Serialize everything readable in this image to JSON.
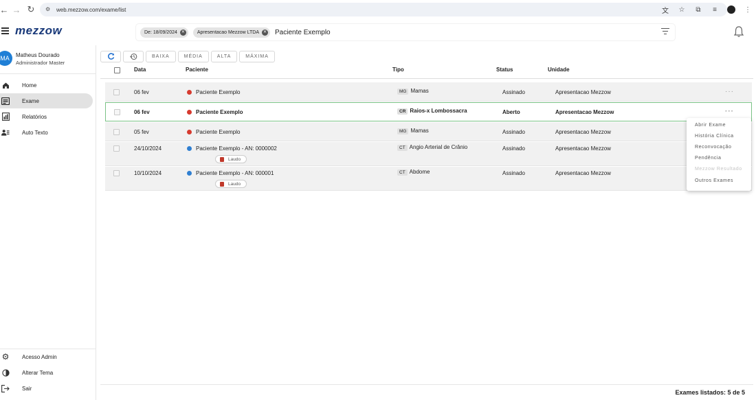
{
  "browser": {
    "url": "web.mezzow.com/exame/list"
  },
  "app": {
    "logo": "mezzow",
    "search": {
      "chips": [
        "De: 18/09/2024",
        "Apresentacao Mezzow LTDA"
      ],
      "query": "Paciente Exemplo"
    }
  },
  "user": {
    "initials": "MA",
    "name": "Matheus Dourado",
    "role": "Administrador Master"
  },
  "nav": {
    "items": [
      {
        "label": "Home",
        "icon": "home-icon"
      },
      {
        "label": "Exame",
        "icon": "exam-list-icon",
        "active": true
      },
      {
        "label": "Relatórios",
        "icon": "reports-icon"
      },
      {
        "label": "Auto Texto",
        "icon": "auto-text-icon"
      }
    ],
    "bottom": [
      {
        "label": "Acesso Admin",
        "icon": "gear-icon"
      },
      {
        "label": "Alterar Tema",
        "icon": "theme-icon"
      },
      {
        "label": "Sair",
        "icon": "logout-icon"
      }
    ]
  },
  "toolbar": {
    "priorities": [
      "BAIXA",
      "MÉDIA",
      "ALTA",
      "MÁXIMA"
    ]
  },
  "table": {
    "headers": {
      "data": "Data",
      "paciente": "Paciente",
      "tipo": "Tipo",
      "status": "Status",
      "unidade": "Unidade"
    },
    "rows": [
      {
        "date": "06 fev",
        "patient": "Paciente Exemplo",
        "dot": "#d63a2f",
        "modality": "MG",
        "type": "Mamas",
        "status": "Assinado",
        "unit": "Apresentacao Mezzow"
      },
      {
        "date": "06 fev",
        "patient": "Paciente Exemplo",
        "dot": "#d63a2f",
        "modality": "CR",
        "type": "Raios-x Lombossacra",
        "status": "Aberto",
        "unit": "Apresentacao Mezzow"
      },
      {
        "date": "05 fev",
        "patient": "Paciente Exemplo",
        "dot": "#d63a2f",
        "modality": "MG",
        "type": "Mamas",
        "status": "Assinado",
        "unit": "Apresentacao Mezzow"
      },
      {
        "date": "24/10/2024",
        "patient": "Paciente Exemplo - AN: 0000002",
        "dot": "#2f7fd1",
        "modality": "CT",
        "type": "Angio Arterial de Crânio",
        "status": "Assinado",
        "unit": "Apresentacao Mezzow",
        "laudo": "Laudo"
      },
      {
        "date": "10/10/2024",
        "patient": "Paciente Exemplo - AN: 000001",
        "dot": "#2f7fd1",
        "modality": "CT",
        "type": "Abdome",
        "status": "Assinado",
        "unit": "Apresentacao Mezzow",
        "laudo": "Laudo"
      }
    ]
  },
  "context_menu": {
    "items": [
      {
        "label": "Abrir Exame",
        "disabled": false
      },
      {
        "label": "História Clínica",
        "disabled": false
      },
      {
        "label": "Reconvocação",
        "disabled": false
      },
      {
        "label": "Pendência",
        "disabled": false
      },
      {
        "label": "Mezzow Resultado",
        "disabled": true
      },
      {
        "label": "Outros Exames",
        "disabled": false
      }
    ]
  },
  "footer": {
    "count_text": "Exames listados: 5 de 5"
  }
}
